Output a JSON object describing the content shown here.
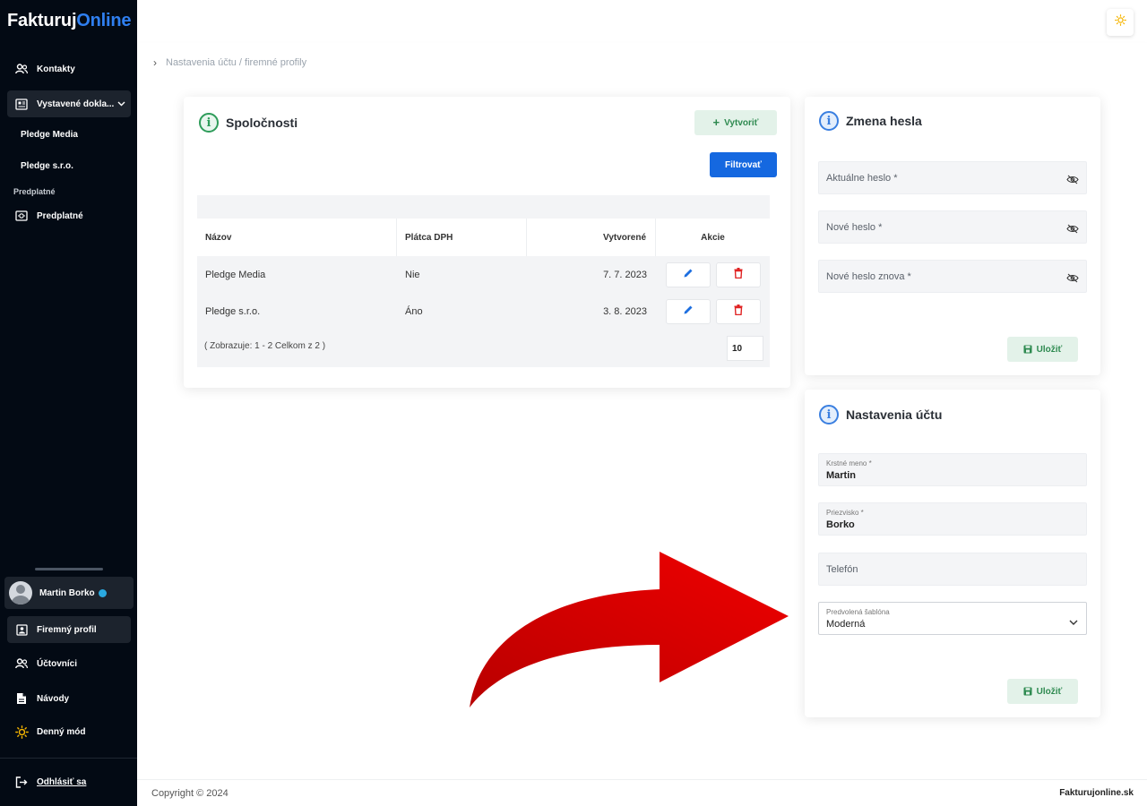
{
  "logo": {
    "part1": "Fakturuj",
    "part2": "Online"
  },
  "sidebar": {
    "contacts": "Kontakty",
    "issued_docs": "Vystavené dokla...",
    "sub_items": [
      "Pledge Media",
      "Pledge s.r.o."
    ],
    "section_subscriptions": "Predplatné",
    "subscriptions": "Predplatné",
    "user_name": "Martin Borko",
    "company_profile": "Firemný profil",
    "accountants": "Účtovníci",
    "guides": "Návody",
    "day_mode": "Denný mód",
    "logout": "Odhlásiť sa"
  },
  "breadcrumb": "Nastavenia účtu / firemné profily",
  "companies": {
    "title": "Spoločnosti",
    "create_label": "Vytvoriť",
    "filter_label": "Filtrovať",
    "columns": [
      "Názov",
      "Plátca DPH",
      "Vytvorené",
      "Akcie"
    ],
    "rows": [
      {
        "name": "Pledge Media",
        "vat": "Nie",
        "created": "7. 7. 2023"
      },
      {
        "name": "Pledge s.r.o.",
        "vat": "Áno",
        "created": "3. 8. 2023"
      }
    ],
    "pager_text": "( Zobrazuje: 1 - 2 Celkom z 2 )",
    "page_size": "10"
  },
  "password": {
    "title": "Zmena hesla",
    "current_placeholder": "Aktuálne heslo *",
    "new_placeholder": "Nové heslo *",
    "repeat_placeholder": "Nové heslo znova *",
    "save_label": "Uložiť"
  },
  "account": {
    "title": "Nastavenia účtu",
    "first_name_label": "Krstné meno *",
    "first_name_value": "Martin",
    "last_name_label": "Priezvisko *",
    "last_name_value": "Borko",
    "phone_placeholder": "Telefón",
    "template_label": "Predvolená šablóna",
    "template_value": "Moderná",
    "save_label": "Uložiť"
  },
  "footer": {
    "copyright": "Copyright © 2024",
    "site": "Fakturujonline.sk"
  },
  "colors": {
    "sidebar_bg": "#030a14",
    "accent_blue": "#1568e0",
    "success_green": "#2e8a50",
    "danger_red": "#e02424",
    "arrow_red": "#e00000"
  }
}
